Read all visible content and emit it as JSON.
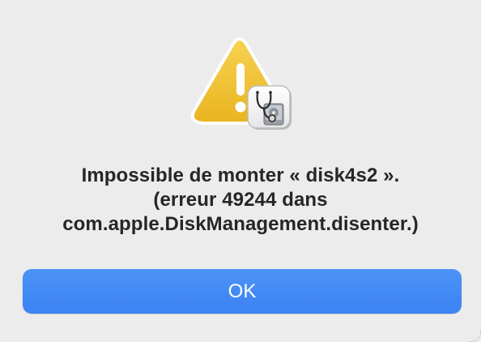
{
  "dialog": {
    "message_lines": [
      "Impossible de monter « disk4s2 ».",
      "(erreur 49244 dans",
      "com.apple.DiskManagement.disenter.)"
    ],
    "ok_label": "OK"
  },
  "icons": {
    "warning": "warning-triangle-icon",
    "badge": "disk-utility-stethoscope-icon"
  },
  "colors": {
    "background": "#ececec",
    "button": "#3b82f3",
    "text": "#262626",
    "warning": "#f2c230"
  }
}
